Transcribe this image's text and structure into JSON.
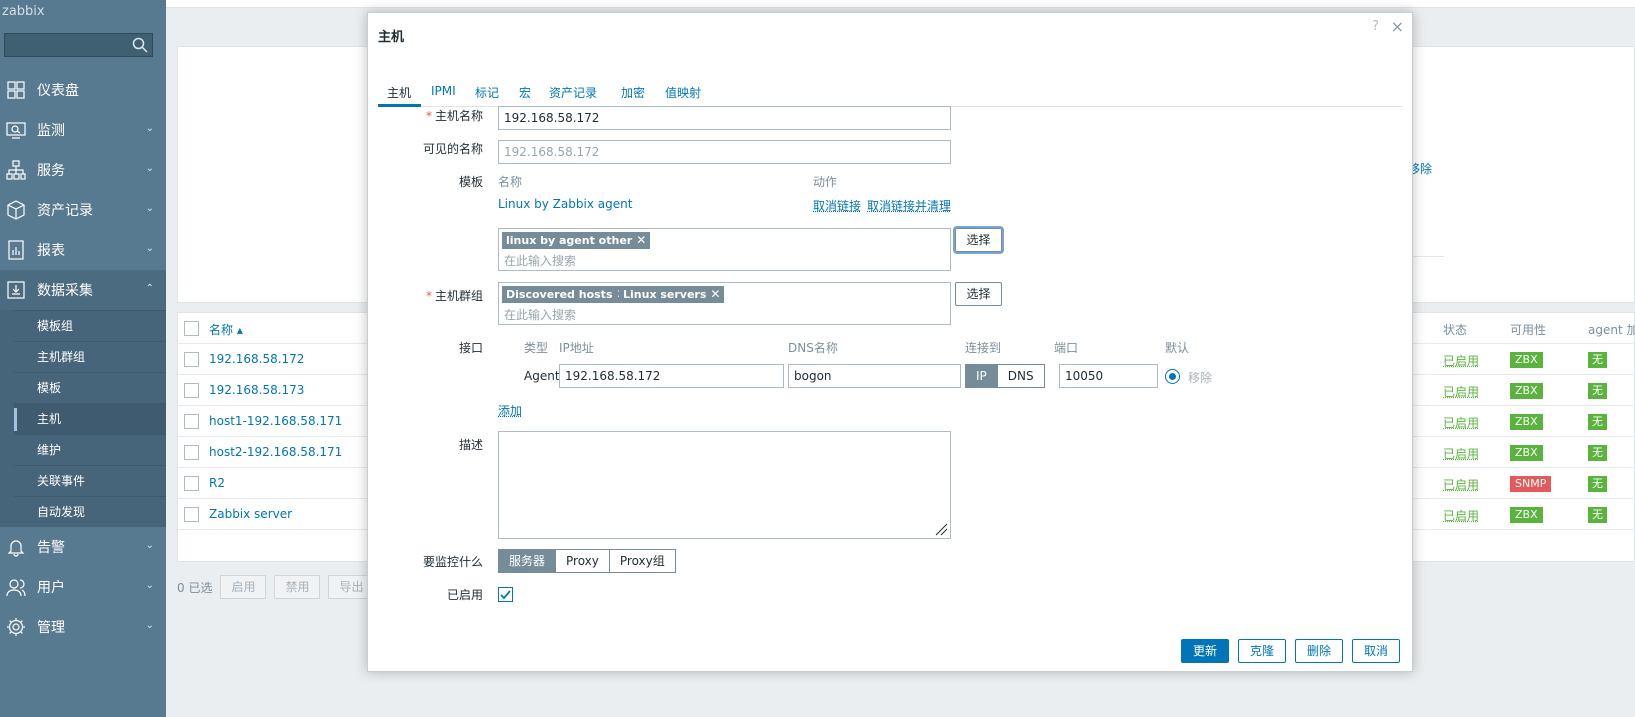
{
  "app": {
    "logo": "zabbix"
  },
  "sidebar": {
    "items": [
      {
        "label": "仪表盘",
        "icon": "dashboard-icon"
      },
      {
        "label": "监测",
        "icon": "monitoring-icon"
      },
      {
        "label": "服务",
        "icon": "services-icon"
      },
      {
        "label": "资产记录",
        "icon": "inventory-icon"
      },
      {
        "label": "报表",
        "icon": "reports-icon"
      },
      {
        "label": "数据采集",
        "icon": "data-collection-icon"
      },
      {
        "label": "告警",
        "icon": "alerts-icon"
      },
      {
        "label": "用户",
        "icon": "users-icon"
      },
      {
        "label": "管理",
        "icon": "administration-icon"
      }
    ],
    "sub_items": [
      {
        "label": "模板组"
      },
      {
        "label": "主机群组"
      },
      {
        "label": "模板"
      },
      {
        "label": "主机"
      },
      {
        "label": "维护"
      },
      {
        "label": "关联事件"
      },
      {
        "label": "自动发现"
      }
    ]
  },
  "background": {
    "partial_link": "移除",
    "table": {
      "col_name": "名称 ▴",
      "col_status": "状态",
      "col_availability": "可用性",
      "col_agent": "agent 加密",
      "rows": [
        {
          "name": "192.168.58.172",
          "status": "已启用",
          "avail": "ZBX",
          "enc": "无"
        },
        {
          "name": "192.168.58.173",
          "status": "已启用",
          "avail": "ZBX",
          "enc": "无"
        },
        {
          "name": "host1-192.168.58.171",
          "status": "已启用",
          "avail": "ZBX",
          "enc": "无"
        },
        {
          "name": "host2-192.168.58.171",
          "status": "已启用",
          "avail": "ZBX",
          "enc": "无"
        },
        {
          "name": "R2",
          "status": "已启用",
          "avail": "SNMP",
          "enc": "无"
        },
        {
          "name": "Zabbix server",
          "status": "已启用",
          "avail": "ZBX",
          "enc": "无"
        }
      ]
    },
    "footer": {
      "selected": "0 已选",
      "enable": "启用",
      "disable": "禁用",
      "export": "导出"
    }
  },
  "modal": {
    "title": "主机",
    "help": "?",
    "close": "×",
    "tabs": [
      "主机",
      "IPMI",
      "标记",
      "宏",
      "资产记录",
      "加密",
      "值映射"
    ],
    "host_name_label": "主机名称",
    "host_name_value": "192.168.58.172",
    "visible_name_label": "可见的名称",
    "visible_name_placeholder": "192.168.58.172",
    "templates_label": "模板",
    "templates_col_name": "名称",
    "templates_col_action": "动作",
    "linked_template": "Linux by Zabbix agent",
    "unlink": "取消链接",
    "unlink_clear": "取消链接并清理",
    "template_chip": "linux by agent other",
    "search_placeholder": "在此输入搜索",
    "select_button": "选择",
    "groups_label": "主机群组",
    "group_chips": [
      "Discovered hosts",
      "Linux servers"
    ],
    "interfaces_label": "接口",
    "if_col_type": "类型",
    "if_col_ip": "IP地址",
    "if_col_dns": "DNS名称",
    "if_col_connect": "连接到",
    "if_col_port": "端口",
    "if_col_default": "默认",
    "if_type": "Agent",
    "if_ip": "192.168.58.172",
    "if_dns": "bogon",
    "if_connect_ip": "IP",
    "if_connect_dns": "DNS",
    "if_port": "10050",
    "if_remove": "移除",
    "add_link": "添加",
    "description_label": "描述",
    "monitored_by_label": "要监控什么",
    "monitored_by_options": [
      "服务器",
      "Proxy",
      "Proxy组"
    ],
    "enabled_label": "已启用",
    "buttons": {
      "update": "更新",
      "clone": "克隆",
      "delete": "删除",
      "cancel": "取消"
    }
  },
  "colors": {
    "accent": "#0275b8",
    "sidebar": "#587a91",
    "success": "#59b33c",
    "danger": "#e45959"
  }
}
